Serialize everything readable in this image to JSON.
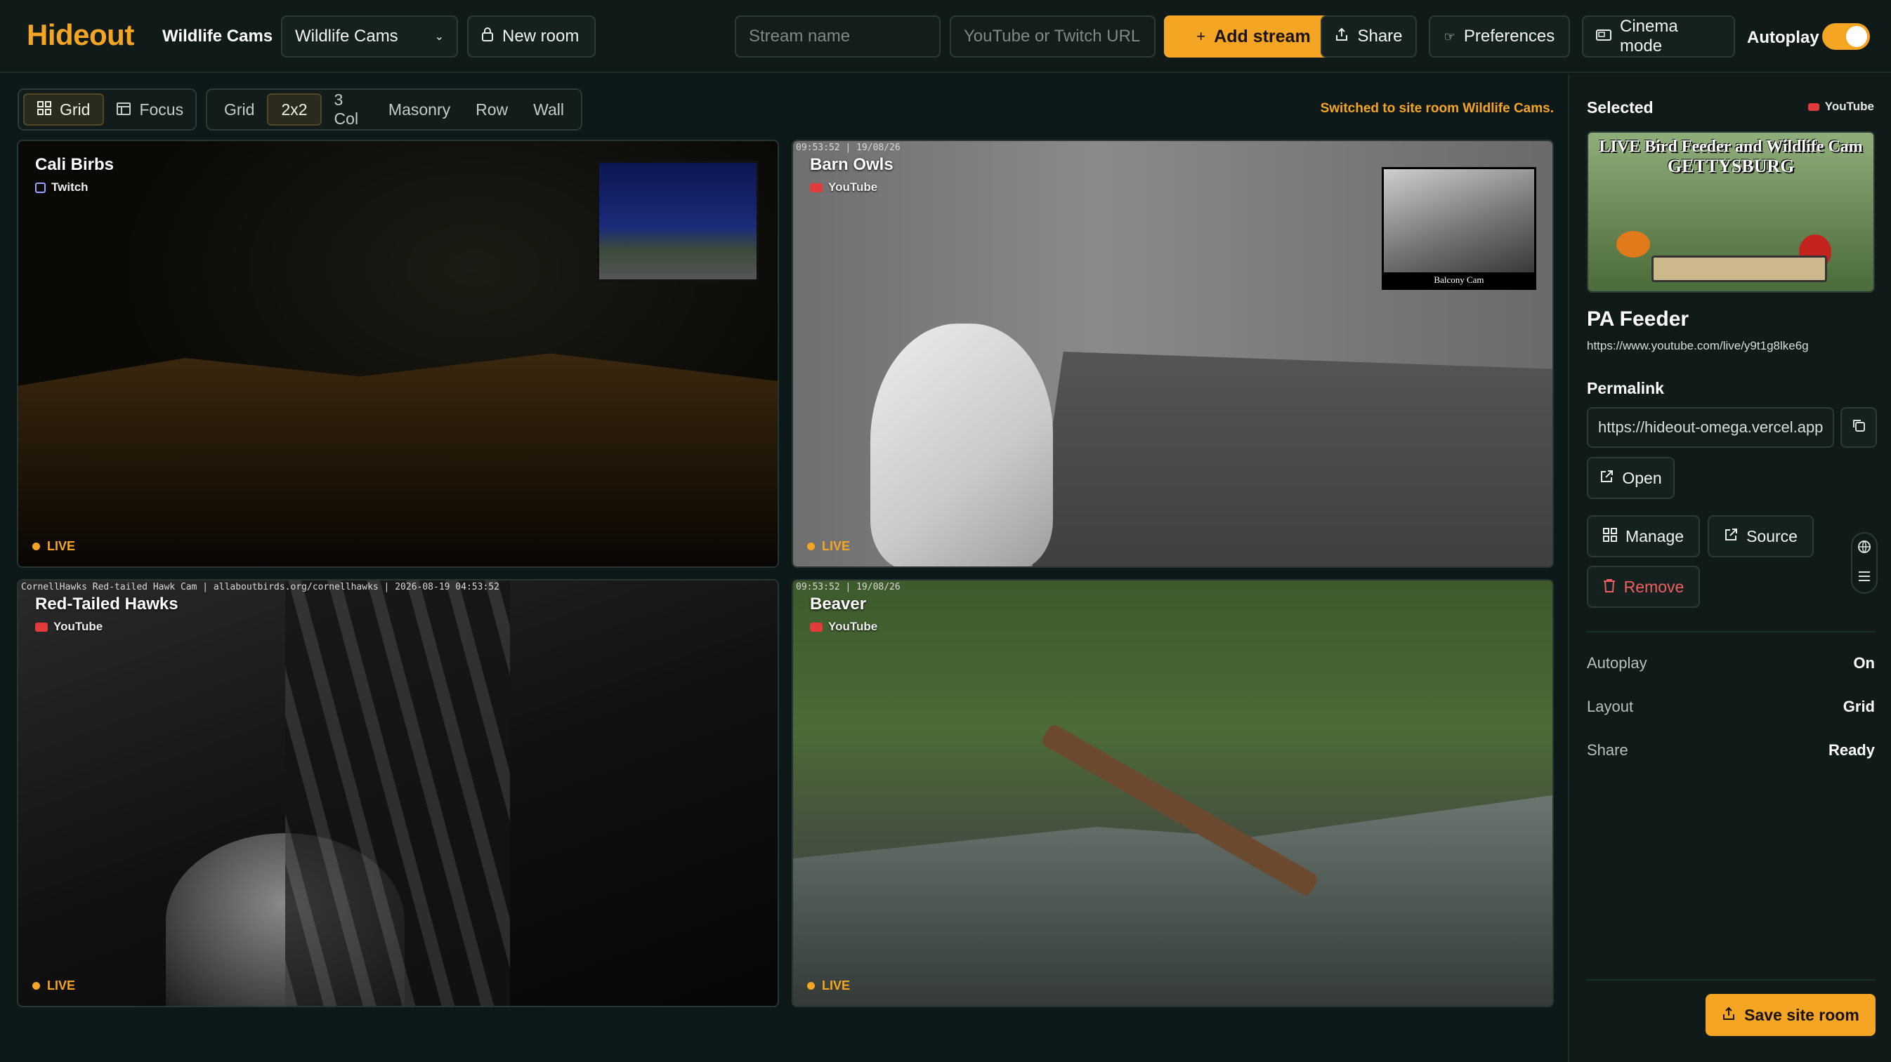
{
  "app": {
    "name": "Hideout",
    "room_label": "Wildlife Cams"
  },
  "toolbar": {
    "room_select_value": "Wildlife Cams",
    "new_room_label": "New room",
    "stream_name_placeholder": "Stream name",
    "url_placeholder": "YouTube or Twitch URL",
    "add_stream_label": "Add stream",
    "share_label": "Share",
    "preferences_label": "Preferences",
    "cinema_label": "Cinema mode",
    "autoplay_label": "Autoplay",
    "autoplay_on": true
  },
  "view_modes": [
    {
      "label": "Grid",
      "active": true
    },
    {
      "label": "Focus",
      "active": false
    }
  ],
  "layouts": [
    {
      "label": "Grid",
      "active": false
    },
    {
      "label": "2x2",
      "active": true
    },
    {
      "label": "3 Col",
      "active": false
    },
    {
      "label": "Masonry",
      "active": false
    },
    {
      "label": "Row",
      "active": false
    },
    {
      "label": "Wall",
      "active": false
    }
  ],
  "notice": "Switched to site room Wildlife Cams.",
  "streams": [
    {
      "name": "Cali Birbs",
      "source": "Twitch",
      "status": "LIVE",
      "overlay": ""
    },
    {
      "name": "Barn Owls",
      "source": "YouTube",
      "status": "LIVE",
      "overlay": "09:53:52 | 19/08/26",
      "pip_caption": "Balcony Cam"
    },
    {
      "name": "Red-Tailed Hawks",
      "source": "YouTube",
      "status": "LIVE",
      "overlay": "CornellHawks Red-tailed Hawk Cam | allaboutbirds.org/cornellhawks | 2026-08-19 04:53:52"
    },
    {
      "name": "Beaver",
      "source": "YouTube",
      "status": "LIVE",
      "overlay": "09:53:52 | 19/08/26"
    }
  ],
  "selected": {
    "heading": "Selected",
    "source": "YouTube",
    "thumb_title_1": "LIVE Bird Feeder and Wildlife Cam",
    "thumb_title_2": "GETTYSBURG",
    "name": "PA Feeder",
    "url": "https://www.youtube.com/live/y9t1g8lke6g",
    "permalink_heading": "Permalink",
    "permalink_value": "https://hideout-omega.vercel.app",
    "open_label": "Open",
    "manage_label": "Manage",
    "source_label": "Source",
    "remove_label": "Remove"
  },
  "status": [
    {
      "key": "Autoplay",
      "value": "On"
    },
    {
      "key": "Layout",
      "value": "Grid"
    },
    {
      "key": "Share",
      "value": "Ready"
    }
  ],
  "save_label": "Save site room",
  "colors": {
    "accent": "#f5a524",
    "background": "#0c1716",
    "danger": "#ef5f5f",
    "youtube": "#e23b3b"
  }
}
